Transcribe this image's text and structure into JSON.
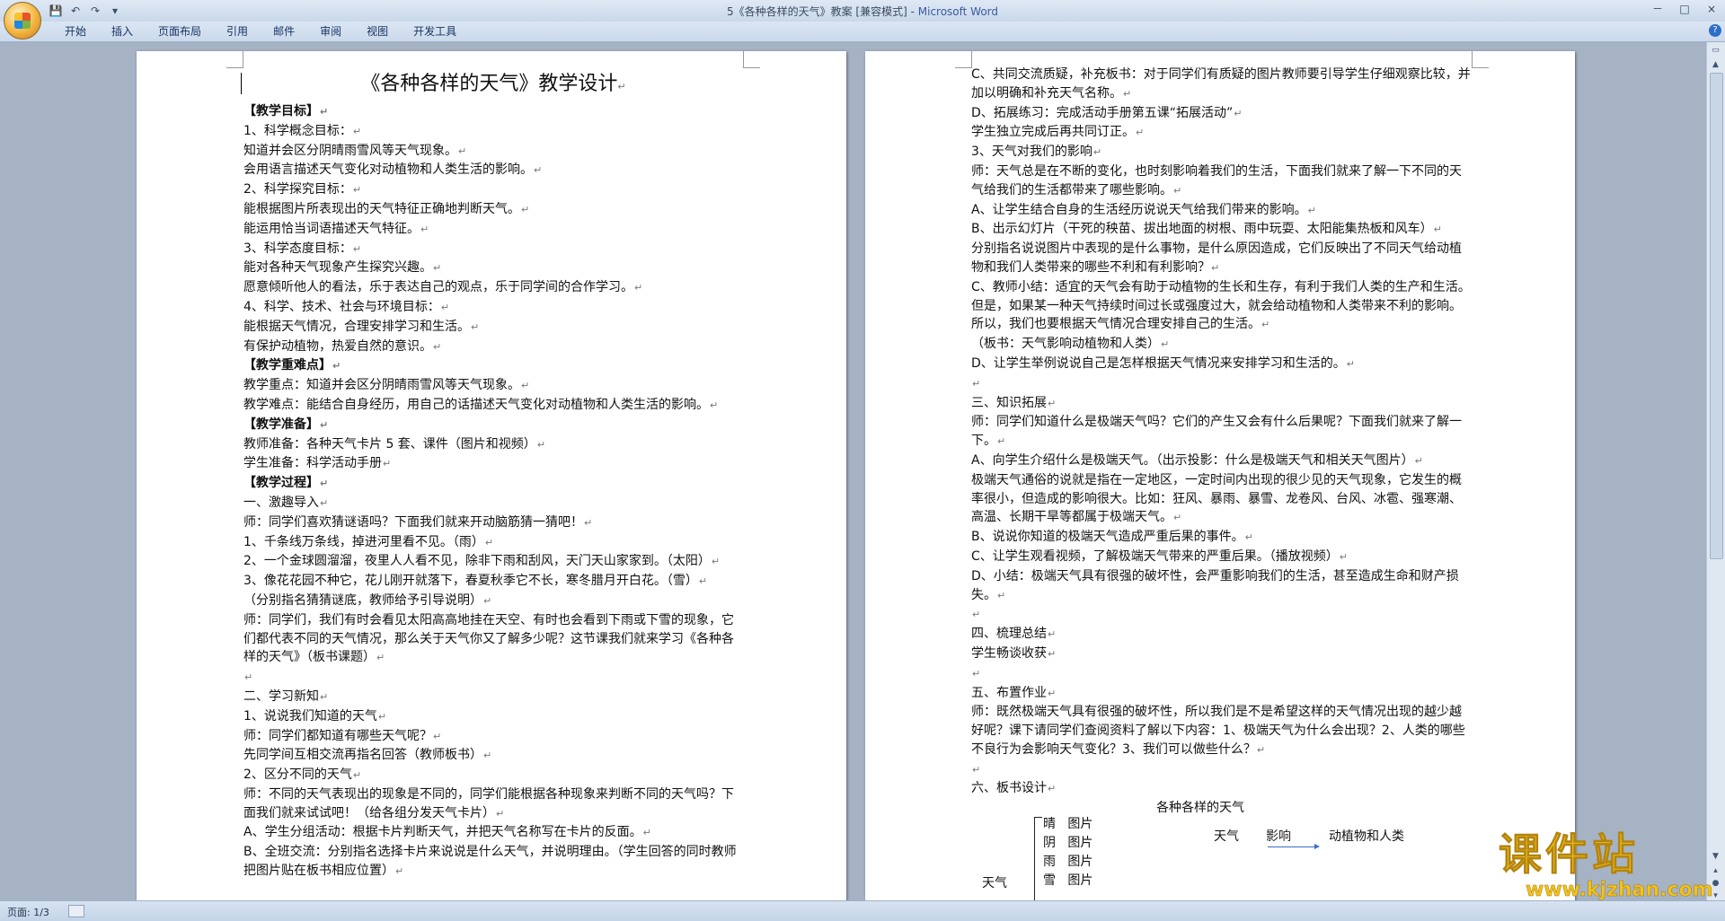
{
  "window": {
    "title": "5《各种各样的天气》教案 [兼容模式] - ",
    "app_name": "Microsoft Word",
    "controls": [
      "－",
      "□",
      "×"
    ]
  },
  "quick_access": {
    "icons": [
      "save-icon",
      "undo-icon",
      "redo-icon",
      "customize-icon"
    ],
    "glyphs": [
      "💾",
      "↶",
      "↷",
      "▾"
    ]
  },
  "ribbon": {
    "tabs": [
      "开始",
      "插入",
      "页面布局",
      "引用",
      "邮件",
      "审阅",
      "视图",
      "开发工具"
    ],
    "help": "?"
  },
  "page1": {
    "title": "《各种各样的天气》教学设计",
    "paragraphs": [
      {
        "text": "【教学目标】",
        "head": true
      },
      {
        "text": " 1、科学概念目标："
      },
      {
        "text": "知道并会区分阴晴雨雪风等天气现象。"
      },
      {
        "text": "会用语言描述天气变化对动植物和人类生活的影响。"
      },
      {
        "text": "2、科学探究目标："
      },
      {
        "text": "能根据图片所表现出的天气特征正确地判断天气。"
      },
      {
        "text": "能运用恰当词语描述天气特征。"
      },
      {
        "text": "3、科学态度目标："
      },
      {
        "text": "能对各种天气现象产生探究兴趣。"
      },
      {
        "text": "愿意倾听他人的看法，乐于表达自己的观点，乐于同学间的合作学习。"
      },
      {
        "text": "4、科学、技术、社会与环境目标："
      },
      {
        "text": "能根据天气情况，合理安排学习和生活。"
      },
      {
        "text": "有保护动植物，热爱自然的意识。"
      },
      {
        "text": "【教学重难点】",
        "head": true
      },
      {
        "text": "教学重点：知道并会区分阴晴雨雪风等天气现象。"
      },
      {
        "text": "教学难点：能结合自身经历，用自己的话描述天气变化对动植物和人类生活的影响。"
      },
      {
        "text": "【教学准备】",
        "head": true
      },
      {
        "text": "教师准备：各种天气卡片 5 套、课件（图片和视频）"
      },
      {
        "text": "学生准备：科学活动手册"
      },
      {
        "text": "【教学过程】",
        "head": true
      },
      {
        "text": "一、激趣导入"
      },
      {
        "text": "师：同学们喜欢猜谜语吗？下面我们就来开动脑筋猜一猜吧！"
      },
      {
        "text": "1、千条线万条线，掉进河里看不见。（雨）"
      },
      {
        "text": "2、一个金球圆溜溜，夜里人人看不见，除非下雨和刮风，天门天山家家到。（太阳）"
      },
      {
        "text": "3、像花花园不种它，花儿刚开就落下，春夏秋季它不长，寒冬腊月开白花。（雪）"
      },
      {
        "text": "（分别指名猜猜谜底，教师给予引导说明）"
      },
      {
        "text": "师：同学们，我们有时会看见太阳高高地挂在天空、有时也会看到下雨或下雪的现象，它们都代表不同的天气情况，那么关于天气你又了解多少呢？这节课我们就来学习《各种各样的天气》（板书课题）"
      },
      {
        "text": ""
      },
      {
        "text": "二、学习新知"
      },
      {
        "text": "1、说说我们知道的天气"
      },
      {
        "text": "师：同学们都知道有哪些天气呢？"
      },
      {
        "text": "先同学间互相交流再指名回答（教师板书）"
      },
      {
        "text": "2、区分不同的天气"
      },
      {
        "text": "师：不同的天气表现出的现象是不同的，同学们能根据各种现象来判断不同的天气吗？下面我们就来试试吧！（给各组分发天气卡片）"
      },
      {
        "text": "A、学生分组活动：根据卡片判断天气，并把天气名称写在卡片的反面。"
      },
      {
        "text": "B、全班交流：分别指名选择卡片来说说是什么天气，并说明理由。（学生回答的同时教师把图片贴在板书相应位置）"
      }
    ]
  },
  "page2": {
    "paragraphs": [
      {
        "text": "C、共同交流质疑，补充板书：对于同学们有质疑的图片教师要引导学生仔细观察比较，并加以明确和补充天气名称。"
      },
      {
        "text": "D、拓展练习：完成活动手册第五课“拓展活动”"
      },
      {
        "text": "学生独立完成后再共同订正。"
      },
      {
        "text": "3、天气对我们的影响"
      },
      {
        "text": "师：天气总是在不断的变化，也时刻影响着我们的生活，下面我们就来了解一下不同的天气给我们的生活都带来了哪些影响。"
      },
      {
        "text": "A、让学生结合自身的生活经历说说天气给我们带来的影响。"
      },
      {
        "text": "B、出示幻灯片（干死的秧苗、拔出地面的树根、雨中玩耍、太阳能集热板和风车）"
      },
      {
        "text": "分别指名说说图片中表现的是什么事物，是什么原因造成，它们反映出了不同天气给动植物和我们人类带来的哪些不利和有利影响？"
      },
      {
        "text": "C、教师小结：适宜的天气会有助于动植物的生长和生存，有利于我们人类的生产和生活。但是，如果某一种天气持续时间过长或强度过大，就会给动植物和人类带来不利的影响。所以，我们也要根据天气情况合理安排自己的生活。"
      },
      {
        "text": "（板书：天气影响动植物和人类）"
      },
      {
        "text": "D、让学生举例说说自己是怎样根据天气情况来安排学习和生活的。"
      },
      {
        "text": ""
      },
      {
        "text": "三、知识拓展"
      },
      {
        "text": "师：同学们知道什么是极端天气吗？它们的产生又会有什么后果呢？下面我们就来了解一下。"
      },
      {
        "text": "A、向学生介绍什么是极端天气。（出示投影：什么是极端天气和相关天气图片）"
      },
      {
        "text": "极端天气通俗的说就是指在一定地区，一定时间内出现的很少见的天气现象，它发生的概率很小，但造成的影响很大。比如：狂风、暴雨、暴雪、龙卷风、台风、冰雹、强寒潮、高温、长期干旱等都属于极端天气。"
      },
      {
        "text": "B、说说你知道的极端天气造成严重后果的事件。"
      },
      {
        "text": "C、让学生观看视频，了解极端天气带来的严重后果。（播放视频）"
      },
      {
        "text": "D、小结：极端天气具有很强的破坏性，会严重影响我们的生活，甚至造成生命和财产损失。"
      },
      {
        "text": ""
      },
      {
        "text": "四、梳理总结"
      },
      {
        "text": "学生畅谈收获"
      },
      {
        "text": ""
      },
      {
        "text": "五、布置作业"
      },
      {
        "text": "师：既然极端天气具有很强的破坏性，所以我们是不是希望这样的天气情况出现的越少越好呢？课下请同学们查阅资料了解以下内容：1、极端天气为什么会出现？2、人类的哪些不良行为会影响天气变化？3、我们可以做些什么？"
      },
      {
        "text": ""
      },
      {
        "text": "六、板书设计"
      }
    ],
    "board": {
      "title": "各种各样的天气",
      "rows": [
        {
          "weather": "晴",
          "label": "图片"
        },
        {
          "weather": "阴",
          "label": "图片"
        },
        {
          "weather": "雨",
          "label": "图片"
        },
        {
          "weather": "雪",
          "label": "图片"
        }
      ],
      "root": "天气",
      "cause": "天气",
      "relation": "影响",
      "effect": "动植物和人类"
    }
  },
  "statusbar": {
    "page_info": "页面: 1/3"
  },
  "watermark": {
    "text": "课件站",
    "url": "www.kjzhan.com"
  }
}
